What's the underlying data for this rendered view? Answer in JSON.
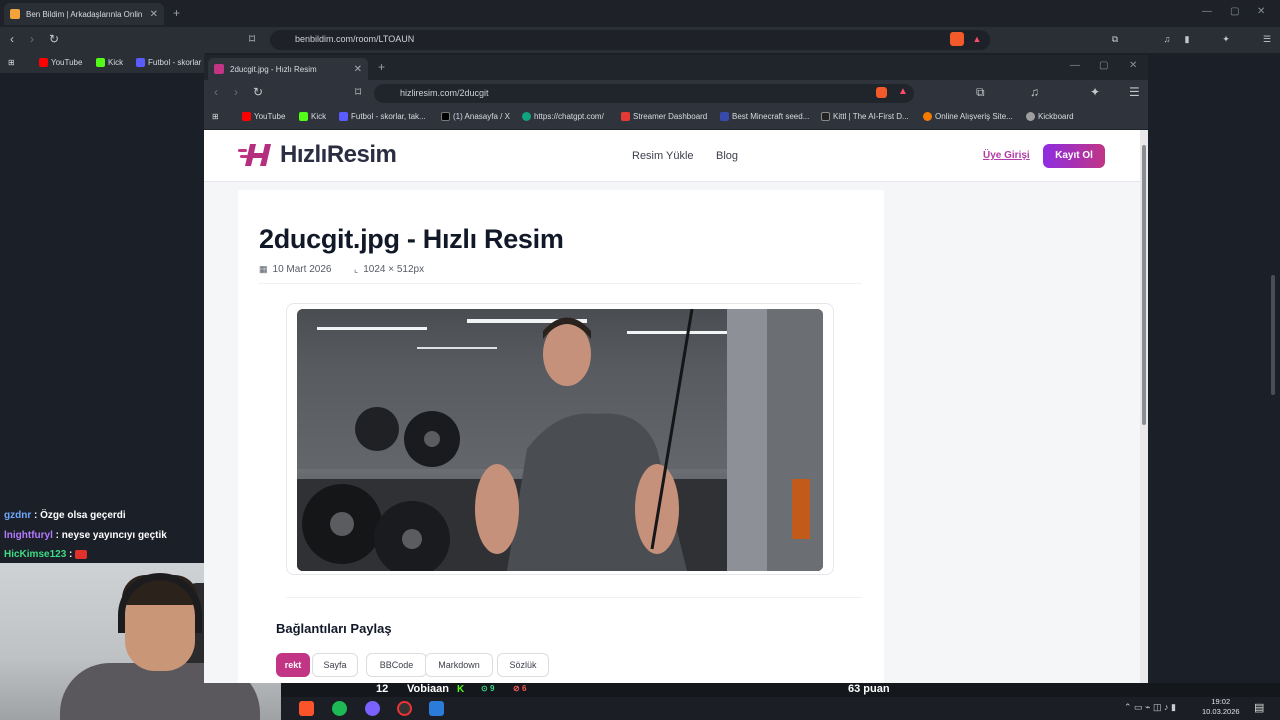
{
  "outer_browser": {
    "tab_title": "Ben Bildim | Arkadaşlarınla Onlin",
    "url": "benbildim.com/room/LTOAUN",
    "bookmarks": [
      {
        "label": "YouTube",
        "color": "#ff0000"
      },
      {
        "label": "Kick",
        "color": "#53fc18"
      },
      {
        "label": "Futbol - skorlar",
        "color": "#5a5cff"
      }
    ]
  },
  "inner_browser": {
    "tab_title": "2ducgit.jpg - Hızlı Resim",
    "url": "hizliresim.com/2ducgit",
    "bookmarks": [
      {
        "label": "YouTube",
        "color": "#ff0000"
      },
      {
        "label": "Kick",
        "color": "#53fc18"
      },
      {
        "label": "Futbol - skorlar, tak...",
        "color": "#5a5cff"
      },
      {
        "label": "(1) Anasayfa / X",
        "color": "#000000"
      },
      {
        "label": "https://chatgpt.com/",
        "color": "#10a37f"
      },
      {
        "label": "Streamer Dashboard",
        "color": "#e53935"
      },
      {
        "label": "Best Minecraft seed...",
        "color": "#3949ab"
      },
      {
        "label": "Kittl | The AI-First D...",
        "color": "#222222"
      },
      {
        "label": "Online Alışveriş Site...",
        "color": "#f57c00"
      },
      {
        "label": "Kickboard",
        "color": "#9e9e9e"
      }
    ]
  },
  "site": {
    "brand": "HızlıResim",
    "nav": [
      "Resim Yükle",
      "Blog"
    ],
    "login": "Üye Girişi",
    "register": "Kayıt Ol",
    "title": "2ducgit.jpg - Hızlı Resim",
    "date": "10 Mart 2026",
    "dimensions": "1024 × 512px",
    "share_title": "Bağlantıları Paylaş",
    "share_tabs": [
      "rekt",
      "Sayfa",
      "BBCode",
      "Markdown",
      "Sözlük"
    ]
  },
  "chat": [
    {
      "user": "gzdnr",
      "text": "Özge olsa geçerdi"
    },
    {
      "user": "lnightfuryl",
      "text": "neyse yayıncıyı geçtik"
    },
    {
      "user": "HicKimse123",
      "text": ""
    }
  ],
  "overlay": {
    "number": "12",
    "player": "Vobiaan",
    "correct": "9",
    "wrong": "6",
    "points": "63 puan"
  },
  "clock": {
    "time": "19:02",
    "date": "10.03.2026"
  }
}
